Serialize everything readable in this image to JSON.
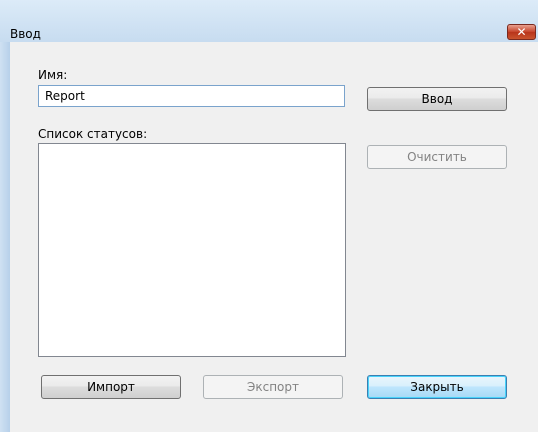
{
  "window": {
    "title": "Ввод",
    "close_glyph": "✕"
  },
  "form": {
    "name_label": "Имя:",
    "name_value": "Report",
    "status_list_label": "Список статусов:",
    "status_items": []
  },
  "buttons": {
    "enter": "Ввод",
    "clear": "Очистить",
    "import": "Импорт",
    "export": "Экспорт",
    "close": "Закрыть"
  },
  "colors": {
    "frame": "#bcd6ee",
    "client_bg": "#f0f0f0",
    "close_button": "#c7462d",
    "default_button_border": "#3c7fb1"
  }
}
